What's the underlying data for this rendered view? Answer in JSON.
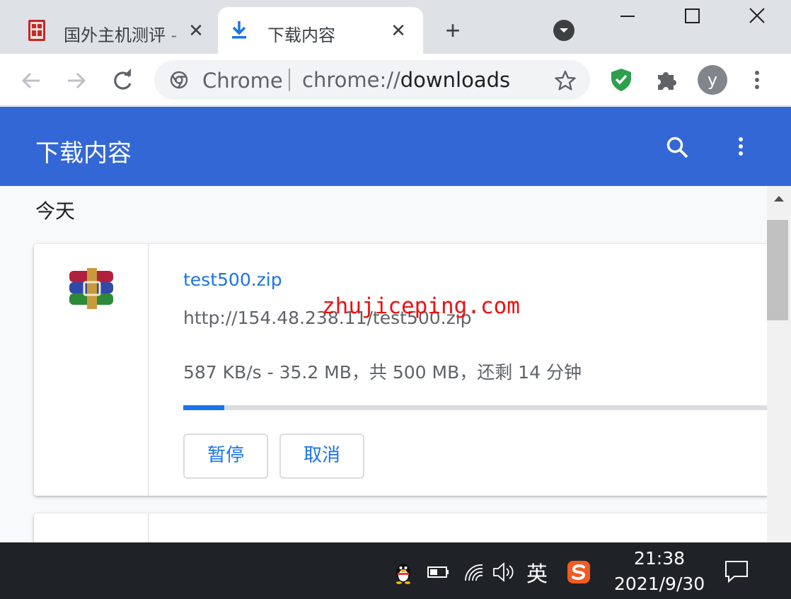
{
  "tabs": [
    {
      "title": "国外主机测评 - ",
      "icon": "site-favicon-icon",
      "close": "✕"
    },
    {
      "title": "下载内容",
      "icon": "download-icon",
      "close": "✕"
    }
  ],
  "tabstrip": {
    "new_tab": "+"
  },
  "omnibox": {
    "origin": "Chrome",
    "url_scheme": "chrome://",
    "url_path": "downloads"
  },
  "profile": {
    "initial": "y"
  },
  "downloads_page": {
    "title": "下载内容",
    "date_group": "今天",
    "items": [
      {
        "file_name": "test500.zip",
        "url": "http://154.48.238.11/test500.zip",
        "status": "587 KB/s - 35.2 MB，共 500 MB，还剩 14 分钟",
        "progress_fraction": 0.0704,
        "pause_label": "暂停",
        "cancel_label": "取消",
        "icon": "winrar-archive-icon"
      }
    ]
  },
  "watermark": "zhujiceping.com",
  "taskbar": {
    "ime": "英",
    "time": "21:38",
    "date": "2021/9/30"
  },
  "colors": {
    "header_blue": "#3367d6",
    "link_blue": "#1a73e8",
    "watermark_red": "#ee1111",
    "shield_green": "#2e9f4a"
  }
}
